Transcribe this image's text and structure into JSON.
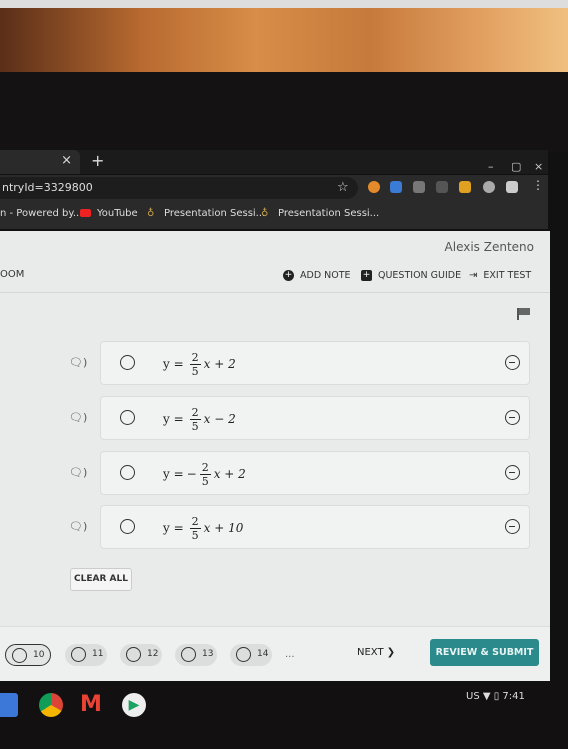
{
  "browser": {
    "tab_close": "×",
    "new_tab": "+",
    "url": "ntryId=3329800",
    "window_controls": [
      "–",
      "▢",
      "×"
    ],
    "bookmarks": [
      "n - Powered by...",
      "YouTube",
      "Presentation Sessi...",
      "Presentation Sessi..."
    ]
  },
  "header": {
    "user": "Alexis Zenteno",
    "section": "OOM",
    "add_note": "ADD NOTE",
    "question_guide": "QUESTION GUIDE",
    "exit_test": "EXIT TEST"
  },
  "choices": [
    {
      "lhs": "y =",
      "sign": "",
      "num": "2",
      "den": "5",
      "rest": "x + 2"
    },
    {
      "lhs": "y =",
      "sign": "",
      "num": "2",
      "den": "5",
      "rest": "x − 2"
    },
    {
      "lhs": "y =",
      "sign": "−",
      "num": "2",
      "den": "5",
      "rest": "x + 2"
    },
    {
      "lhs": "y =",
      "sign": "",
      "num": "2",
      "den": "5",
      "rest": "x + 10"
    }
  ],
  "clear_all": "CLEAR ALL",
  "footer": {
    "questions": [
      "10",
      "11",
      "12",
      "13",
      "14"
    ],
    "current": "10",
    "ellipsis": "...",
    "next": "NEXT ❯",
    "review_submit": "REVIEW & SUBMIT"
  },
  "shelf": {
    "status": "US ▼ ▯ 7:41"
  },
  "colors": {
    "accent": "#2a8a8c"
  }
}
